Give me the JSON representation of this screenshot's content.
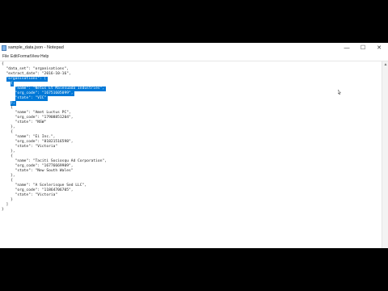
{
  "window": {
    "title": "sample_data.json - Notepad",
    "controls": {
      "minimize": "—",
      "maximize": "☐",
      "close": "✕"
    }
  },
  "menu": [
    "File",
    "Edit",
    "Format",
    "View",
    "Help"
  ],
  "editor": {
    "lines": [
      "{",
      "  \"data_set\": \"organisations\",",
      "  \"extract_date\": \"2016-10-16\",",
      "  \"organisations\": [",
      "    {",
      "      \"name\": \"Netus Et Malesuada Industries\",",
      "      \"org_code\": \"16751605099\",",
      "      \"state\": \"VIC\"",
      "    },",
      "    {",
      "      \"name\": \"Amet Luctus PC\",",
      "      \"org_code\": \"17908851204\",",
      "      \"state\": \"NSW\"",
      "    },",
      "    {",
      "      \"name\": \"Ei Inc.\",",
      "      \"org_code\": \"81821516598\",",
      "      \"state\": \"Victoria\"",
      "    },",
      "    {",
      "      \"name\": \"Taciti Sociosqu Ad Corporation\",",
      "      \"org_code\": \"16776669909\",",
      "      \"state\": \"New South Wales\"",
      "    },",
      "    {",
      "      \"name\": \"A Scelerisque Sed LLC\",",
      "      \"org_code\": \"11864706705\",",
      "      \"state\": \"Victoria\"",
      "    }",
      "  ]",
      "}"
    ],
    "selected_lines": [
      3,
      4,
      5,
      6,
      7,
      8
    ]
  }
}
